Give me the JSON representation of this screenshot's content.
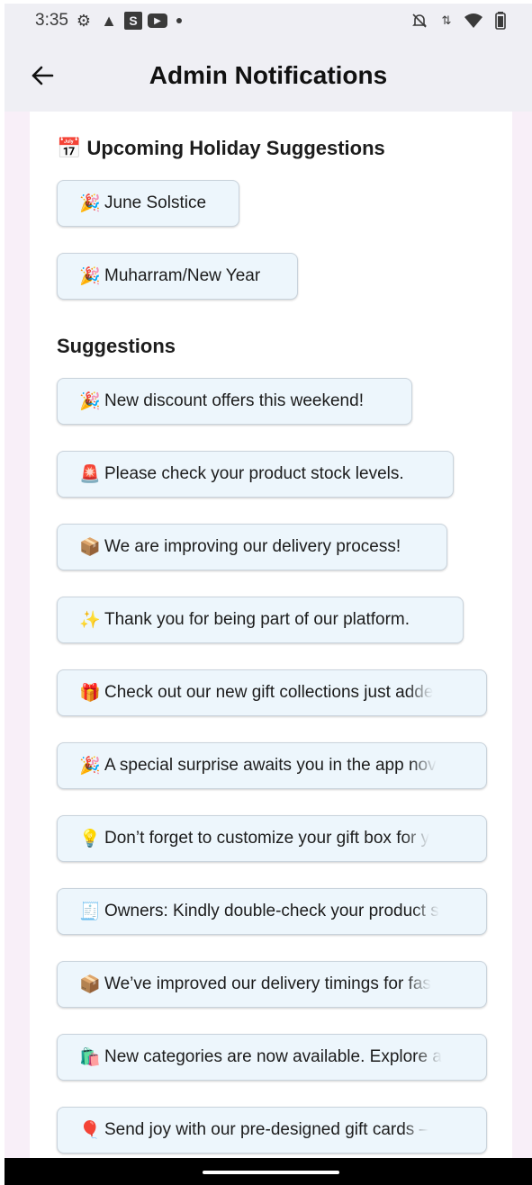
{
  "status_bar": {
    "time": "3:35",
    "left_icons": [
      "settings-gear-icon",
      "warning-triangle-icon",
      "s-app-icon",
      "youtube-icon",
      "notification-dot-icon"
    ],
    "right_icons": [
      "silent-bell-icon",
      "data-arrows-icon",
      "wifi-icon",
      "battery-icon"
    ]
  },
  "app_bar": {
    "back_icon": "arrow-left-icon",
    "title": "Admin Notifications"
  },
  "holiday_section": {
    "icon": "📅",
    "title": "Upcoming Holiday Suggestions",
    "items": [
      {
        "emoji": "🎉",
        "text": "June Solstice"
      },
      {
        "emoji": "🎉",
        "text": "Muharram/New Year"
      }
    ]
  },
  "suggestions_section": {
    "title": "Suggestions",
    "items": [
      {
        "emoji": "🎉",
        "text": "New discount offers this weekend!"
      },
      {
        "emoji": "🚨",
        "text": "Please check your product stock levels."
      },
      {
        "emoji": "📦",
        "text": "We are improving our delivery process!"
      },
      {
        "emoji": "✨",
        "text": "Thank you for being part of our platform."
      },
      {
        "emoji": "🎁",
        "text": "Check out our new gift collections just adde"
      },
      {
        "emoji": "🎉",
        "text": "A special surprise awaits you in the app nov"
      },
      {
        "emoji": "💡",
        "text": "Don’t forget to customize your gift box for y"
      },
      {
        "emoji": "🧾",
        "text": "Owners: Kindly double-check your product s"
      },
      {
        "emoji": "📦",
        "text": "We’ve improved our delivery timings for fas"
      },
      {
        "emoji": "🛍️",
        "text": "New categories are now available. Explore a"
      },
      {
        "emoji": "🎈",
        "text": "Send joy with our pre-designed gift cards –"
      }
    ]
  }
}
